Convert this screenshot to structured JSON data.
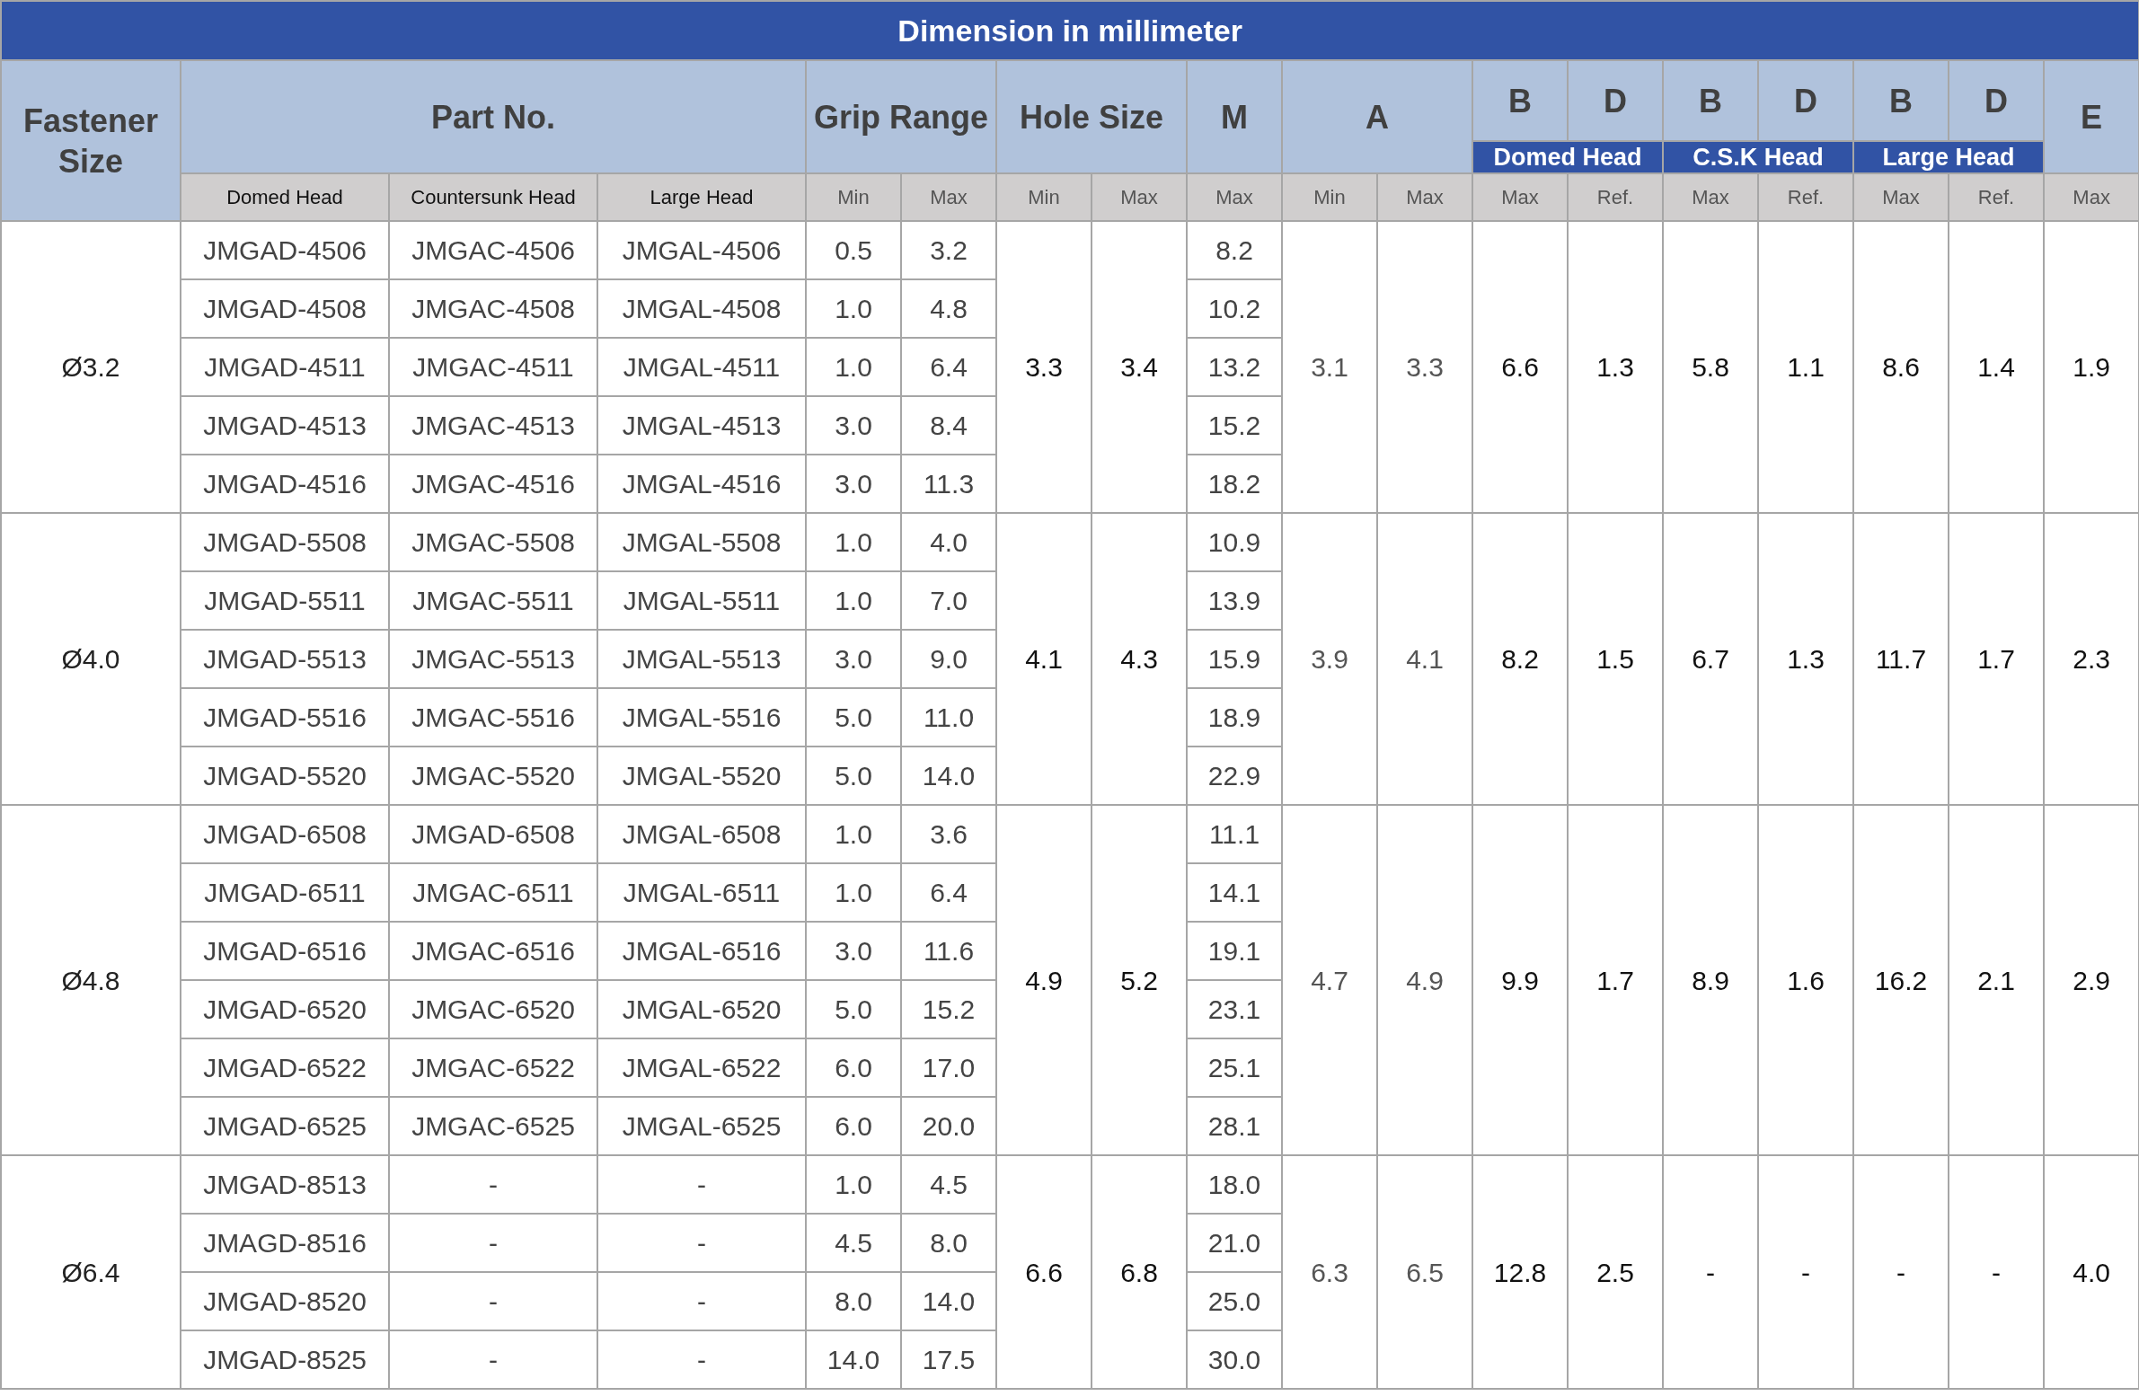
{
  "title": "Dimension in millimeter",
  "header": {
    "fastener_size": "Fastener Size",
    "part_no": "Part No.",
    "grip_range": "Grip Range",
    "hole_size": "Hole Size",
    "m": "M",
    "a": "A",
    "e": "E",
    "head_columns": [
      {
        "b": "B",
        "d": "D",
        "label": "Domed Head"
      },
      {
        "b": "B",
        "d": "D",
        "label": "C.S.K Head"
      },
      {
        "b": "B",
        "d": "D",
        "label": "Large Head"
      }
    ]
  },
  "subheaders": [
    "Domed Head",
    "Countersunk Head",
    "Large Head",
    "Min",
    "Max",
    "Min",
    "Max",
    "Max",
    "Min",
    "Max",
    "Max",
    "Ref.",
    "Max",
    "Ref.",
    "Max",
    "Ref.",
    "Max"
  ],
  "groups": [
    {
      "size": "Ø3.2",
      "hole_min": "3.3",
      "hole_max": "3.4",
      "a_min": "3.1",
      "a_max": "3.3",
      "heads": [
        {
          "b": "6.6",
          "d": "1.3"
        },
        {
          "b": "5.8",
          "d": "1.1"
        },
        {
          "b": "8.6",
          "d": "1.4"
        }
      ],
      "e": "1.9",
      "rows": [
        [
          "JMGAD-4506",
          "JMGAC-4506",
          "JMGAL-4506",
          "0.5",
          "3.2",
          "8.2"
        ],
        [
          "JMGAD-4508",
          "JMGAC-4508",
          "JMGAL-4508",
          "1.0",
          "4.8",
          "10.2"
        ],
        [
          "JMGAD-4511",
          "JMGAC-4511",
          "JMGAL-4511",
          "1.0",
          "6.4",
          "13.2"
        ],
        [
          "JMGAD-4513",
          "JMGAC-4513",
          "JMGAL-4513",
          "3.0",
          "8.4",
          "15.2"
        ],
        [
          "JMGAD-4516",
          "JMGAC-4516",
          "JMGAL-4516",
          "3.0",
          "11.3",
          "18.2"
        ]
      ]
    },
    {
      "size": "Ø4.0",
      "hole_min": "4.1",
      "hole_max": "4.3",
      "a_min": "3.9",
      "a_max": "4.1",
      "heads": [
        {
          "b": "8.2",
          "d": "1.5"
        },
        {
          "b": "6.7",
          "d": "1.3"
        },
        {
          "b": "11.7",
          "d": "1.7"
        }
      ],
      "e": "2.3",
      "rows": [
        [
          "JMGAD-5508",
          "JMGAC-5508",
          "JMGAL-5508",
          "1.0",
          "4.0",
          "10.9"
        ],
        [
          "JMGAD-5511",
          "JMGAC-5511",
          "JMGAL-5511",
          "1.0",
          "7.0",
          "13.9"
        ],
        [
          "JMGAD-5513",
          "JMGAC-5513",
          "JMGAL-5513",
          "3.0",
          "9.0",
          "15.9"
        ],
        [
          "JMGAD-5516",
          "JMGAC-5516",
          "JMGAL-5516",
          "5.0",
          "11.0",
          "18.9"
        ],
        [
          "JMGAD-5520",
          "JMGAC-5520",
          "JMGAL-5520",
          "5.0",
          "14.0",
          "22.9"
        ]
      ]
    },
    {
      "size": "Ø4.8",
      "hole_min": "4.9",
      "hole_max": "5.2",
      "a_min": "4.7",
      "a_max": "4.9",
      "heads": [
        {
          "b": "9.9",
          "d": "1.7"
        },
        {
          "b": "8.9",
          "d": "1.6"
        },
        {
          "b": "16.2",
          "d": "2.1"
        }
      ],
      "e": "2.9",
      "rows": [
        [
          "JMGAD-6508",
          "JMGAD-6508",
          "JMGAL-6508",
          "1.0",
          "3.6",
          "11.1"
        ],
        [
          "JMGAD-6511",
          "JMGAC-6511",
          "JMGAL-6511",
          "1.0",
          "6.4",
          "14.1"
        ],
        [
          "JMGAD-6516",
          "JMGAC-6516",
          "JMGAL-6516",
          "3.0",
          "11.6",
          "19.1"
        ],
        [
          "JMGAD-6520",
          "JMGAC-6520",
          "JMGAL-6520",
          "5.0",
          "15.2",
          "23.1"
        ],
        [
          "JMGAD-6522",
          "JMGAC-6522",
          "JMGAL-6522",
          "6.0",
          "17.0",
          "25.1"
        ],
        [
          "JMGAD-6525",
          "JMGAC-6525",
          "JMGAL-6525",
          "6.0",
          "20.0",
          "28.1"
        ]
      ]
    },
    {
      "size": "Ø6.4",
      "hole_min": "6.6",
      "hole_max": "6.8",
      "a_min": "6.3",
      "a_max": "6.5",
      "heads": [
        {
          "b": "12.8",
          "d": "2.5"
        },
        {
          "b": "-",
          "d": "-"
        },
        {
          "b": "-",
          "d": "-"
        }
      ],
      "e": "4.0",
      "rows": [
        [
          "JMGAD-8513",
          "-",
          "-",
          "1.0",
          "4.5",
          "18.0"
        ],
        [
          "JMAGD-8516",
          "-",
          "-",
          "4.5",
          "8.0",
          "21.0"
        ],
        [
          "JMGAD-8520",
          "-",
          "-",
          "8.0",
          "14.0",
          "25.0"
        ],
        [
          "JMGAD-8525",
          "-",
          "-",
          "14.0",
          "17.5",
          "30.0"
        ]
      ]
    }
  ]
}
